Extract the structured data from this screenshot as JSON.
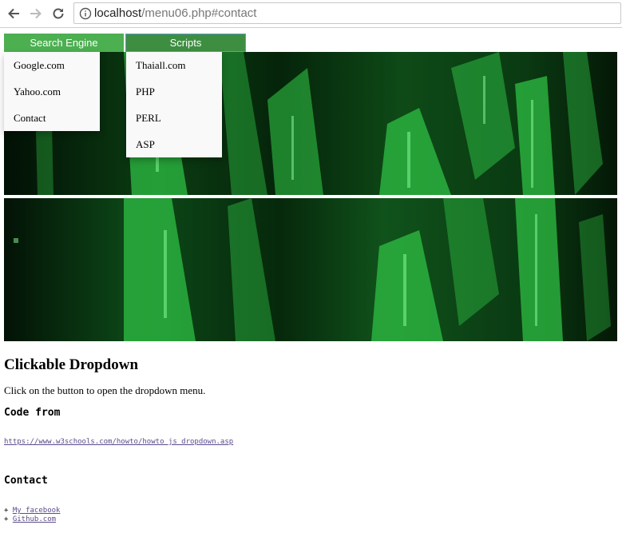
{
  "browser": {
    "url_host": "localhost",
    "url_path": "/menu06.php#contact"
  },
  "dropdowns": [
    {
      "label": "Search Engine",
      "items": [
        "Google.com",
        "Yahoo.com",
        "Contact"
      ]
    },
    {
      "label": "Scripts",
      "items": [
        "Thaiall.com",
        "PHP",
        "PERL",
        "ASP"
      ]
    }
  ],
  "content": {
    "title": "Clickable Dropdown",
    "description": "Click on the button to open the dropdown menu.",
    "code_heading": "Code from",
    "code_link": "https://www.w3schools.com/howto/howto_js_dropdown.asp",
    "contact_heading": "Contact",
    "contact_bullet": "+",
    "contact_links": [
      "My facebook",
      "Github.com"
    ]
  },
  "colors": {
    "button_green": "#4caf50",
    "button_green_active": "#3e8e41",
    "banner_green": "#2ecc40"
  }
}
